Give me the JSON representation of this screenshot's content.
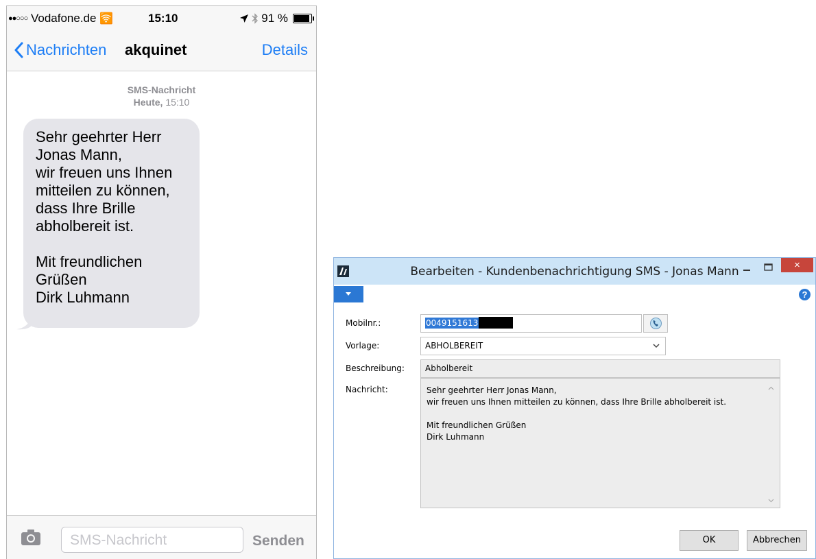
{
  "phone": {
    "status": {
      "carrier": "Vodafone.de",
      "time": "15:10",
      "battery_text": "91 %",
      "battery_level": 0.91
    },
    "nav": {
      "back_label": "Nachrichten",
      "title": "akquinet",
      "details_label": "Details"
    },
    "thread": {
      "type_label": "SMS-Nachricht",
      "date_label": "Heute,",
      "date_time": "15:10"
    },
    "message_lines": [
      "Sehr geehrter Herr",
      "Jonas Mann,",
      "wir freuen uns Ihnen",
      "mitteilen zu können,",
      "dass Ihre Brille",
      "abholbereit ist.",
      "",
      "Mit freundlichen",
      "Grüßen",
      "Dirk Luhmann"
    ],
    "input": {
      "placeholder": "SMS-Nachricht",
      "send_label": "Senden"
    }
  },
  "dialog": {
    "title": "Bearbeiten - Kundenbenachrichtigung SMS - Jonas Mann",
    "close_glyph": "×",
    "help_glyph": "?",
    "fields": {
      "mobile_label": "Mobilnr.:",
      "mobile_value": "0049151613",
      "template_label": "Vorlage:",
      "template_value": "ABHOLBEREIT",
      "description_label": "Beschreibung:",
      "description_value": "Abholbereit",
      "message_label": "Nachricht:"
    },
    "message_lines": [
      "Sehr geehrter Herr Jonas Mann,",
      "wir freuen uns Ihnen mitteilen zu können, dass Ihre Brille abholbereit ist.",
      "",
      "Mit freundlichen Grüßen",
      "Dirk Luhmann"
    ],
    "buttons": {
      "ok": "OK",
      "cancel": "Abbrechen"
    },
    "colors": {
      "titlebar": "#cce4f7",
      "accent": "#2b78d4",
      "close": "#c7453b"
    }
  },
  "colors": {
    "ios_blue": "#1e7ef5",
    "bubble_gray": "#e5e5ea"
  }
}
